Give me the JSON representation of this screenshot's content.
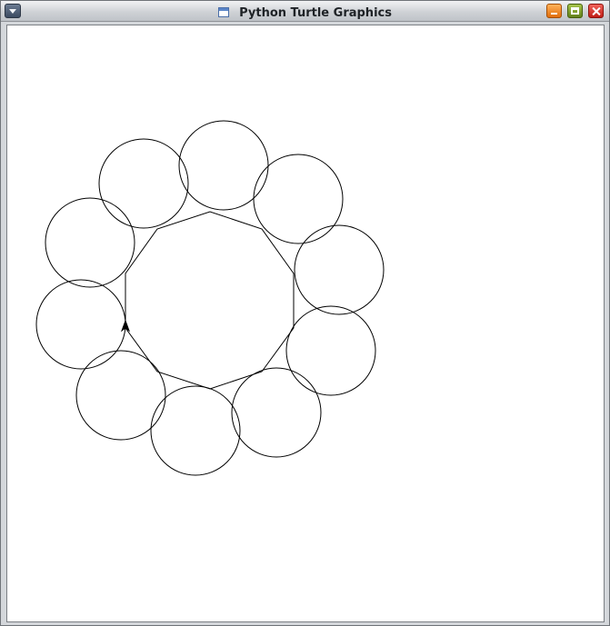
{
  "window": {
    "title": "Python Turtle Graphics",
    "icons": {
      "menu": "window-menu-icon",
      "app": "app-window-icon",
      "minimize": "minimize-icon",
      "maximize": "maximize-icon",
      "close": "close-icon"
    }
  },
  "colors": {
    "pen": "#000000",
    "canvas": "#ffffff",
    "minimize": "#f08a26",
    "maximize": "#7c9a2c",
    "close": "#d8342b"
  }
}
